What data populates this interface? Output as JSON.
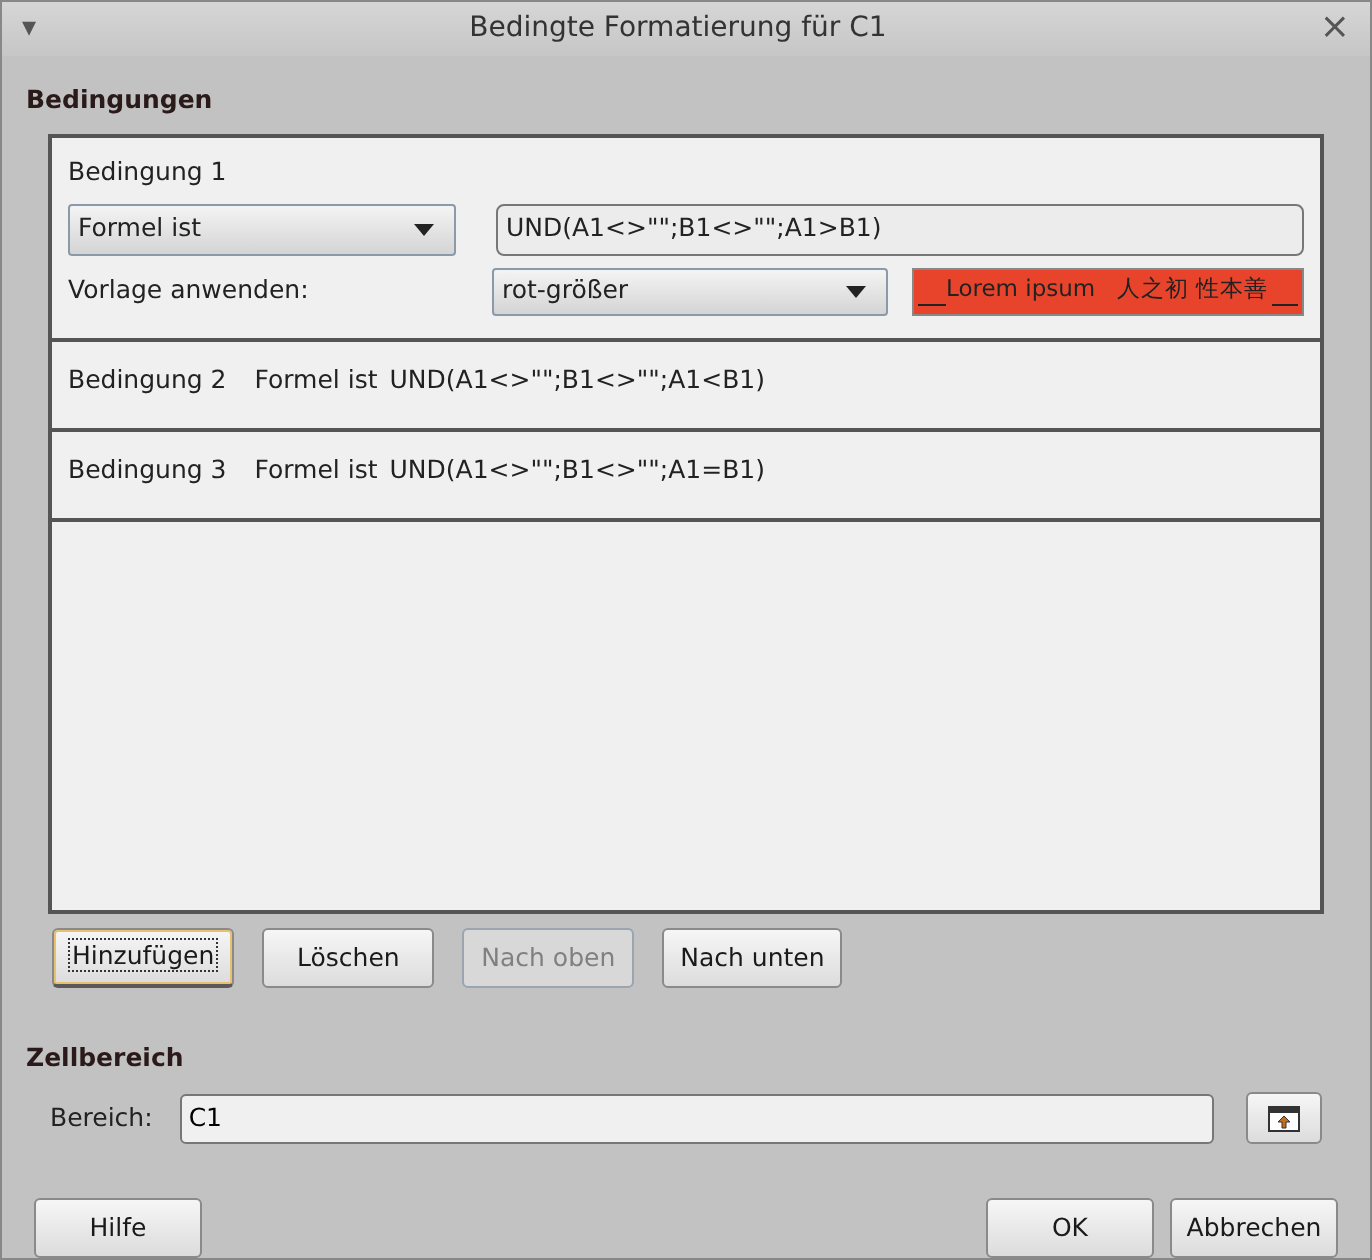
{
  "window": {
    "title": "Bedingte Formatierung für C1",
    "menu_glyph": "▾",
    "close_glyph": "×"
  },
  "conditions_section": {
    "heading": "Bedingungen"
  },
  "conditions": [
    {
      "expanded": true,
      "title": "Bedingung 1",
      "type": "Formel ist",
      "formula": "UND(A1<>\"\";B1<>\"\";A1>B1)",
      "style_label": "Vorlage anwenden:",
      "style": "rot-größer",
      "preview": "Lorem ipsum   人之初 性本善",
      "color": "#e8442c"
    },
    {
      "expanded": false,
      "title": "Bedingung 2",
      "type": "Formel ist",
      "formula": "UND(A1<>\"\";B1<>\"\";A1<B1)"
    },
    {
      "expanded": false,
      "title": "Bedingung 3",
      "type": "Formel ist",
      "formula": "UND(A1<>\"\";B1<>\"\";A1=B1)"
    }
  ],
  "list_buttons": [
    {
      "label": "Hinzufügen",
      "disabled": false,
      "focused": true
    },
    {
      "label": "Löschen",
      "disabled": false,
      "focused": false
    },
    {
      "label": "Nach oben",
      "disabled": true,
      "focused": false
    },
    {
      "label": "Nach unten",
      "disabled": false,
      "focused": false
    }
  ],
  "range_section": {
    "heading": "Zellbereich",
    "label": "Bereich:",
    "value": "C1"
  },
  "footer_buttons": [
    {
      "label": "Hilfe"
    },
    {
      "label": "OK"
    },
    {
      "label": "Abbrechen"
    }
  ]
}
